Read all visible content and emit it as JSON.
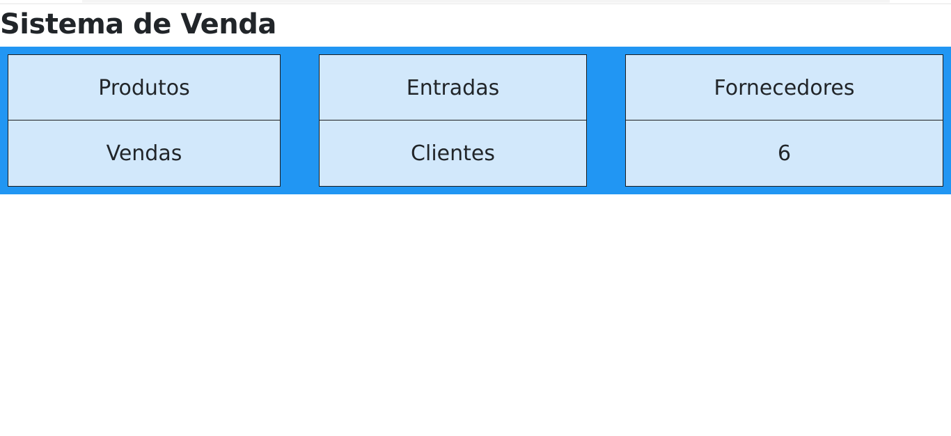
{
  "page": {
    "title": "Sistema de Venda"
  },
  "menu": {
    "items": [
      {
        "label": "Produtos"
      },
      {
        "label": "Entradas"
      },
      {
        "label": "Fornecedores"
      },
      {
        "label": "Vendas"
      },
      {
        "label": "Clientes"
      },
      {
        "label": "6"
      }
    ]
  },
  "colors": {
    "panel_background": "#2196f3",
    "cell_background": "#d2e8fb",
    "cell_border": "#1c1c1c",
    "text": "#212529"
  }
}
